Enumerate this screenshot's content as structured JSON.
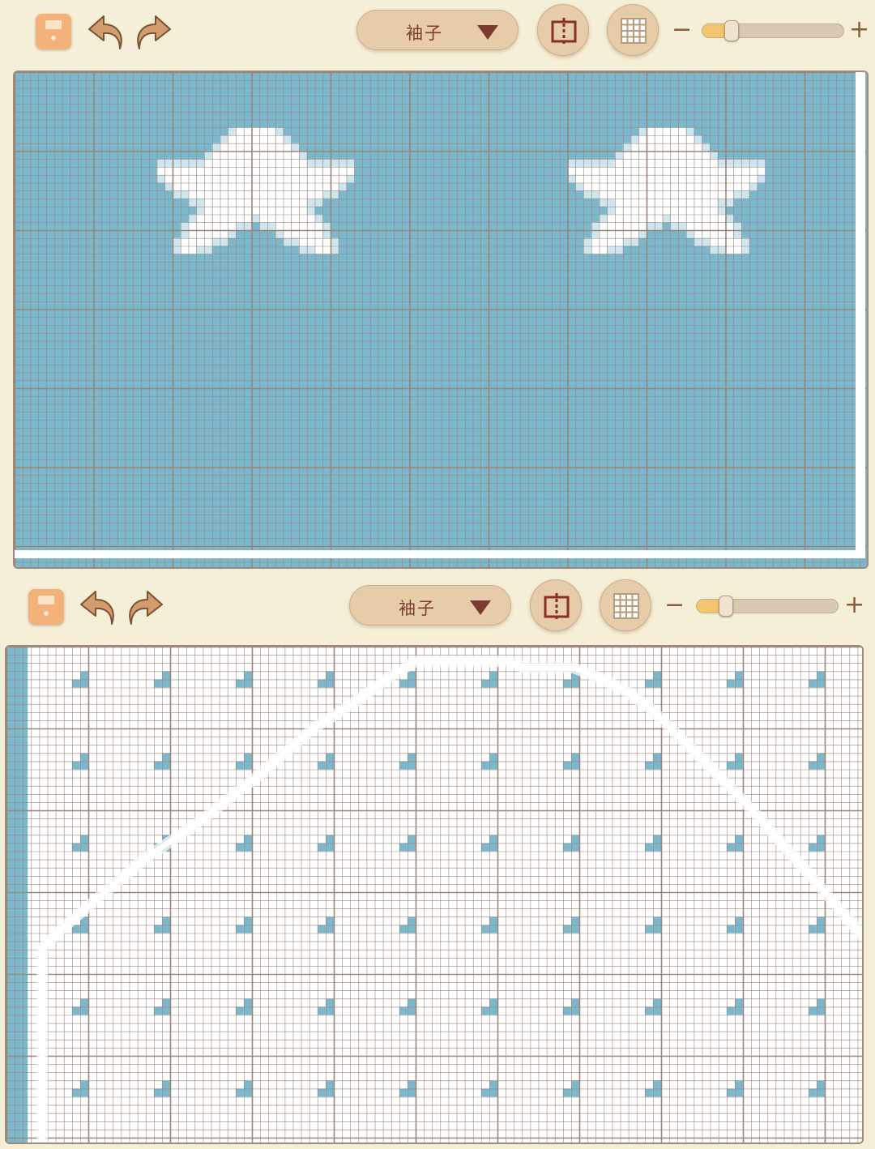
{
  "colors": {
    "background": "#f6efd8",
    "yarn_blue": "#7bb8cd",
    "yarn_white": "#ffffff",
    "yarn_edge": "#cfe6ee",
    "grid_line": "#9a8578",
    "accent": "#f3b27a",
    "button_fill": "#e6cca8",
    "label_text": "#7b3b30"
  },
  "toolbars": [
    {
      "save_icon": "floppy-disk-icon",
      "undo_icon": "undo-arrow-icon",
      "redo_icon": "redo-arrow-icon",
      "piece_dropdown": {
        "selected": "袖子",
        "icon": "caret-down-icon"
      },
      "mirror_icon": "mirror-split-icon",
      "grid_icon": "grid-toggle-icon",
      "zoom": {
        "minus": "−",
        "plus": "+",
        "level": 0.12
      }
    },
    {
      "save_icon": "floppy-disk-icon",
      "undo_icon": "undo-arrow-icon",
      "redo_icon": "redo-arrow-icon",
      "piece_dropdown": {
        "selected": "袖子",
        "icon": "caret-down-icon"
      },
      "mirror_icon": "mirror-split-icon",
      "grid_icon": "grid-toggle-icon",
      "zoom": {
        "minus": "−",
        "plus": "+",
        "level": 0.12
      }
    }
  ],
  "charts": [
    {
      "pattern": "two-stars",
      "background_yarn": "blue",
      "motif_yarn": "white"
    },
    {
      "pattern": "diagonal-dots-with-sleeve-outline",
      "background_yarn": "white",
      "motif_yarn": "blue"
    }
  ]
}
